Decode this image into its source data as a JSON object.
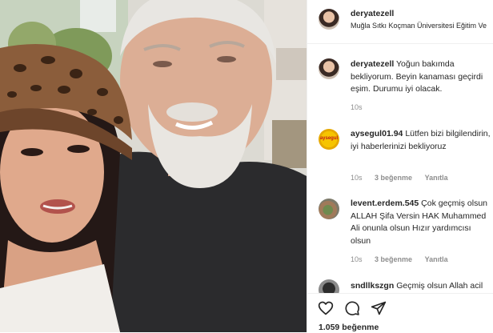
{
  "post": {
    "author": "deryatezell",
    "location": "Muğla Sıtkı Koçman Üniversitesi Eğitim Ve"
  },
  "caption": {
    "username": "deryatezell",
    "text": "Yoğun bakımda bekliyorum. Beyin kanaması geçirdi eşim. Durumu iyi olacak.",
    "time": "10s"
  },
  "comments": [
    {
      "username": "aysegul01.94",
      "avatar_text": "aysegul",
      "text": "Lütfen bizi bilgilendirin, iyi haberlerinizi bekliyoruz",
      "time": "10s",
      "likes": "3 beğenme",
      "reply": "Yanıtla"
    },
    {
      "username": "levent.erdem.545",
      "text": "Çok geçmiş olsun ALLAH Şifa Versin HAK Muhammed Ali onunla olsun Hızır yardımcısı olsun",
      "time": "10s",
      "likes": "3 beğenme",
      "reply": "Yanıtla"
    },
    {
      "username": "sndllkszgn",
      "text": "Geçmiş olsun Allah acil"
    }
  ],
  "actions": {
    "like_icon": "heart-icon",
    "comment_icon": "comment-icon",
    "share_icon": "share-icon"
  },
  "likes_count": "1.059 beğenme",
  "colors": {
    "text": "#262626",
    "secondary": "#8e8e8e",
    "divider": "#efefef"
  }
}
